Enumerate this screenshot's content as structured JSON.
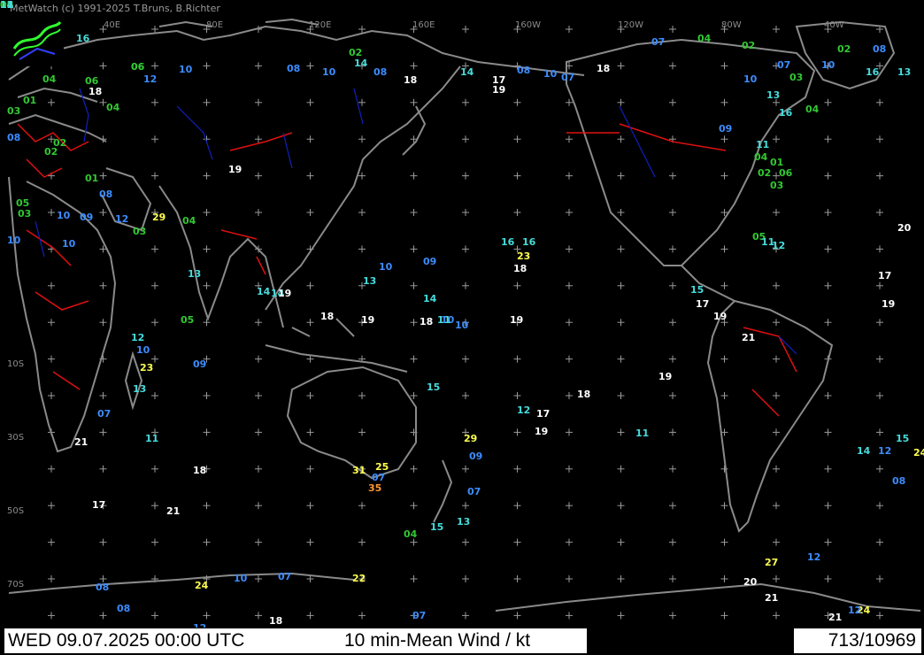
{
  "credit": "MetWatch (c) 1991-2025 T.Bruns, B.Richter",
  "footer": {
    "date_time": "WED 09.07.2025 00:00 UTC",
    "parameter": "10 min-Mean Wind / kt",
    "count": "713/10969"
  },
  "longitude_labels": [
    "40E",
    "80E",
    "120E",
    "160E",
    "160W",
    "120W",
    "80W",
    "40W"
  ],
  "latitude_labels": [
    "10S",
    "30S",
    "50S",
    "70S"
  ],
  "wind_colors": {
    "calm": "#32c832",
    "light": "#3c8cff",
    "moderate": "#46dcdc",
    "fresh": "#ffffff",
    "strong": "#ffff50",
    "gale": "#ff9632"
  },
  "observations": [
    {
      "v": "16",
      "c": "moderate"
    },
    {
      "v": "06",
      "c": "calm"
    },
    {
      "v": "10",
      "c": "light"
    },
    {
      "v": "08",
      "c": "light"
    },
    {
      "v": "10",
      "c": "light"
    },
    {
      "v": "02",
      "c": "calm"
    },
    {
      "v": "14",
      "c": "moderate"
    },
    {
      "v": "08",
      "c": "light"
    },
    {
      "v": "18",
      "c": "fresh"
    },
    {
      "v": "14",
      "c": "moderate"
    },
    {
      "v": "17",
      "c": "fresh"
    },
    {
      "v": "19",
      "c": "fresh"
    },
    {
      "v": "08",
      "c": "light"
    },
    {
      "v": "10",
      "c": "light"
    },
    {
      "v": "07",
      "c": "light"
    },
    {
      "v": "18",
      "c": "fresh"
    },
    {
      "v": "07",
      "c": "light"
    },
    {
      "v": "04",
      "c": "calm"
    },
    {
      "v": "02",
      "c": "calm"
    },
    {
      "v": "07",
      "c": "light"
    },
    {
      "v": "10",
      "c": "light"
    },
    {
      "v": "16",
      "c": "moderate"
    },
    {
      "v": "13",
      "c": "moderate"
    },
    {
      "v": "06",
      "c": "calm"
    },
    {
      "v": "18",
      "c": "fresh"
    },
    {
      "v": "04",
      "c": "calm"
    },
    {
      "v": "06",
      "c": "calm"
    },
    {
      "v": "12",
      "c": "light"
    },
    {
      "v": "01",
      "c": "calm"
    },
    {
      "v": "03",
      "c": "calm"
    },
    {
      "v": "08",
      "c": "light"
    },
    {
      "v": "04",
      "c": "calm"
    },
    {
      "v": "02",
      "c": "calm"
    },
    {
      "v": "19",
      "c": "fresh"
    },
    {
      "v": "02",
      "c": "calm"
    },
    {
      "v": "05",
      "c": "calm"
    },
    {
      "v": "03",
      "c": "calm"
    },
    {
      "v": "10",
      "c": "light"
    },
    {
      "v": "08",
      "c": "light"
    },
    {
      "v": "01",
      "c": "calm"
    },
    {
      "v": "12",
      "c": "light"
    },
    {
      "v": "29",
      "c": "strong"
    },
    {
      "v": "04",
      "c": "calm"
    },
    {
      "v": "03",
      "c": "calm"
    },
    {
      "v": "10",
      "c": "light"
    },
    {
      "v": "10",
      "c": "light"
    },
    {
      "v": "09",
      "c": "light"
    },
    {
      "v": "13",
      "c": "moderate"
    },
    {
      "v": "14",
      "c": "moderate"
    },
    {
      "v": "14",
      "c": "moderate"
    },
    {
      "v": "19",
      "c": "fresh"
    },
    {
      "v": "18",
      "c": "fresh"
    },
    {
      "v": "05",
      "c": "calm"
    },
    {
      "v": "12",
      "c": "moderate"
    },
    {
      "v": "10",
      "c": "light"
    },
    {
      "v": "23",
      "c": "strong"
    },
    {
      "v": "09",
      "c": "light"
    },
    {
      "v": "13",
      "c": "moderate"
    },
    {
      "v": "07",
      "c": "light"
    },
    {
      "v": "11",
      "c": "moderate"
    },
    {
      "v": "21",
      "c": "fresh"
    },
    {
      "v": "18",
      "c": "fresh"
    },
    {
      "v": "21",
      "c": "fresh"
    },
    {
      "v": "17",
      "c": "fresh"
    },
    {
      "v": "19",
      "c": "fresh"
    },
    {
      "v": "18",
      "c": "fresh"
    },
    {
      "v": "10",
      "c": "light"
    },
    {
      "v": "19",
      "c": "fresh"
    },
    {
      "v": "16",
      "c": "moderate"
    },
    {
      "v": "16",
      "c": "moderate"
    },
    {
      "v": "23",
      "c": "strong"
    },
    {
      "v": "18",
      "c": "fresh"
    },
    {
      "v": "09",
      "c": "light"
    },
    {
      "v": "10",
      "c": "light"
    },
    {
      "v": "13",
      "c": "moderate"
    },
    {
      "v": "14",
      "c": "moderate"
    },
    {
      "v": "10",
      "c": "light"
    },
    {
      "v": "11",
      "c": "moderate"
    },
    {
      "v": "15",
      "c": "moderate"
    },
    {
      "v": "12",
      "c": "moderate"
    },
    {
      "v": "18",
      "c": "fresh"
    },
    {
      "v": "19",
      "c": "fresh"
    },
    {
      "v": "17",
      "c": "fresh"
    },
    {
      "v": "11",
      "c": "moderate"
    },
    {
      "v": "19",
      "c": "fresh"
    },
    {
      "v": "09",
      "c": "light"
    },
    {
      "v": "29",
      "c": "strong"
    },
    {
      "v": "25",
      "c": "strong"
    },
    {
      "v": "07",
      "c": "light"
    },
    {
      "v": "35",
      "c": "gale"
    },
    {
      "v": "31",
      "c": "strong"
    },
    {
      "v": "07",
      "c": "light"
    },
    {
      "v": "15",
      "c": "moderate"
    },
    {
      "v": "13",
      "c": "moderate"
    },
    {
      "v": "04",
      "c": "calm"
    },
    {
      "v": "27",
      "c": "strong"
    },
    {
      "v": "12",
      "c": "light"
    },
    {
      "v": "08",
      "c": "light"
    },
    {
      "v": "14",
      "c": "moderate"
    },
    {
      "v": "12",
      "c": "light"
    },
    {
      "v": "15",
      "c": "moderate"
    },
    {
      "v": "20",
      "c": "fresh"
    },
    {
      "v": "17",
      "c": "fresh"
    },
    {
      "v": "19",
      "c": "fresh"
    },
    {
      "v": "24",
      "c": "strong"
    },
    {
      "v": "20",
      "c": "fresh"
    },
    {
      "v": "21",
      "c": "fresh"
    },
    {
      "v": "24",
      "c": "strong"
    },
    {
      "v": "21",
      "c": "fresh"
    },
    {
      "v": "12",
      "c": "light"
    },
    {
      "v": "08",
      "c": "light"
    },
    {
      "v": "24",
      "c": "strong"
    },
    {
      "v": "10",
      "c": "light"
    },
    {
      "v": "07",
      "c": "light"
    },
    {
      "v": "22",
      "c": "strong"
    },
    {
      "v": "08",
      "c": "light"
    },
    {
      "v": "18",
      "c": "fresh"
    },
    {
      "v": "12",
      "c": "light"
    },
    {
      "v": "07",
      "c": "light"
    },
    {
      "v": "02",
      "c": "calm"
    },
    {
      "v": "08",
      "c": "light"
    },
    {
      "v": "03",
      "c": "calm"
    },
    {
      "v": "04",
      "c": "calm"
    },
    {
      "v": "10",
      "c": "light"
    },
    {
      "v": "13",
      "c": "moderate"
    },
    {
      "v": "16",
      "c": "moderate"
    },
    {
      "v": "09",
      "c": "light"
    },
    {
      "v": "11",
      "c": "moderate"
    },
    {
      "v": "01",
      "c": "calm"
    },
    {
      "v": "06",
      "c": "calm"
    },
    {
      "v": "04",
      "c": "calm"
    },
    {
      "v": "02",
      "c": "calm"
    },
    {
      "v": "03",
      "c": "calm"
    },
    {
      "v": "05",
      "c": "calm"
    },
    {
      "v": "11",
      "c": "moderate"
    },
    {
      "v": "12",
      "c": "moderate"
    },
    {
      "v": "15",
      "c": "moderate"
    },
    {
      "v": "17",
      "c": "fresh"
    },
    {
      "v": "19",
      "c": "fresh"
    },
    {
      "v": "21",
      "c": "fresh"
    },
    {
      "v": "06",
      "c": "calm"
    },
    {
      "v": "02",
      "c": "calm"
    },
    {
      "v": "03",
      "c": "calm"
    },
    {
      "v": "11",
      "c": "moderate"
    },
    {
      "v": "14",
      "c": "moderate"
    }
  ]
}
